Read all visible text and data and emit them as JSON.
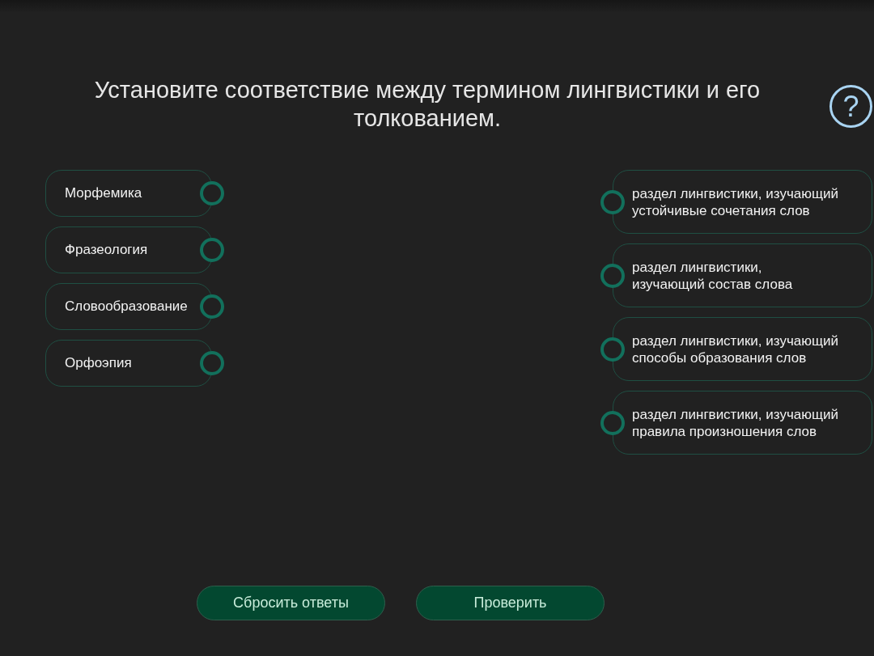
{
  "question": "Установите соответствие между термином лингвистики и его толкованием.",
  "help": "?",
  "terms": [
    {
      "label": "Морфемика"
    },
    {
      "label": "Фразеология"
    },
    {
      "label": "Словообразование"
    },
    {
      "label": "Орфоэпия"
    }
  ],
  "definitions": [
    {
      "lines": [
        "раздел лингвистики, изучающий",
        "устойчивые сочетания слов"
      ]
    },
    {
      "lines": [
        "раздел лингвистики,",
        "изучающий состав слова"
      ]
    },
    {
      "lines": [
        "раздел лингвистики, изучающий",
        "способы образования слов"
      ]
    },
    {
      "lines": [
        "раздел лингвистики, изучающий",
        "правила произношения слов"
      ]
    }
  ],
  "buttons": [
    {
      "label": "Сбросить ответы"
    },
    {
      "label": "Проверить"
    }
  ]
}
